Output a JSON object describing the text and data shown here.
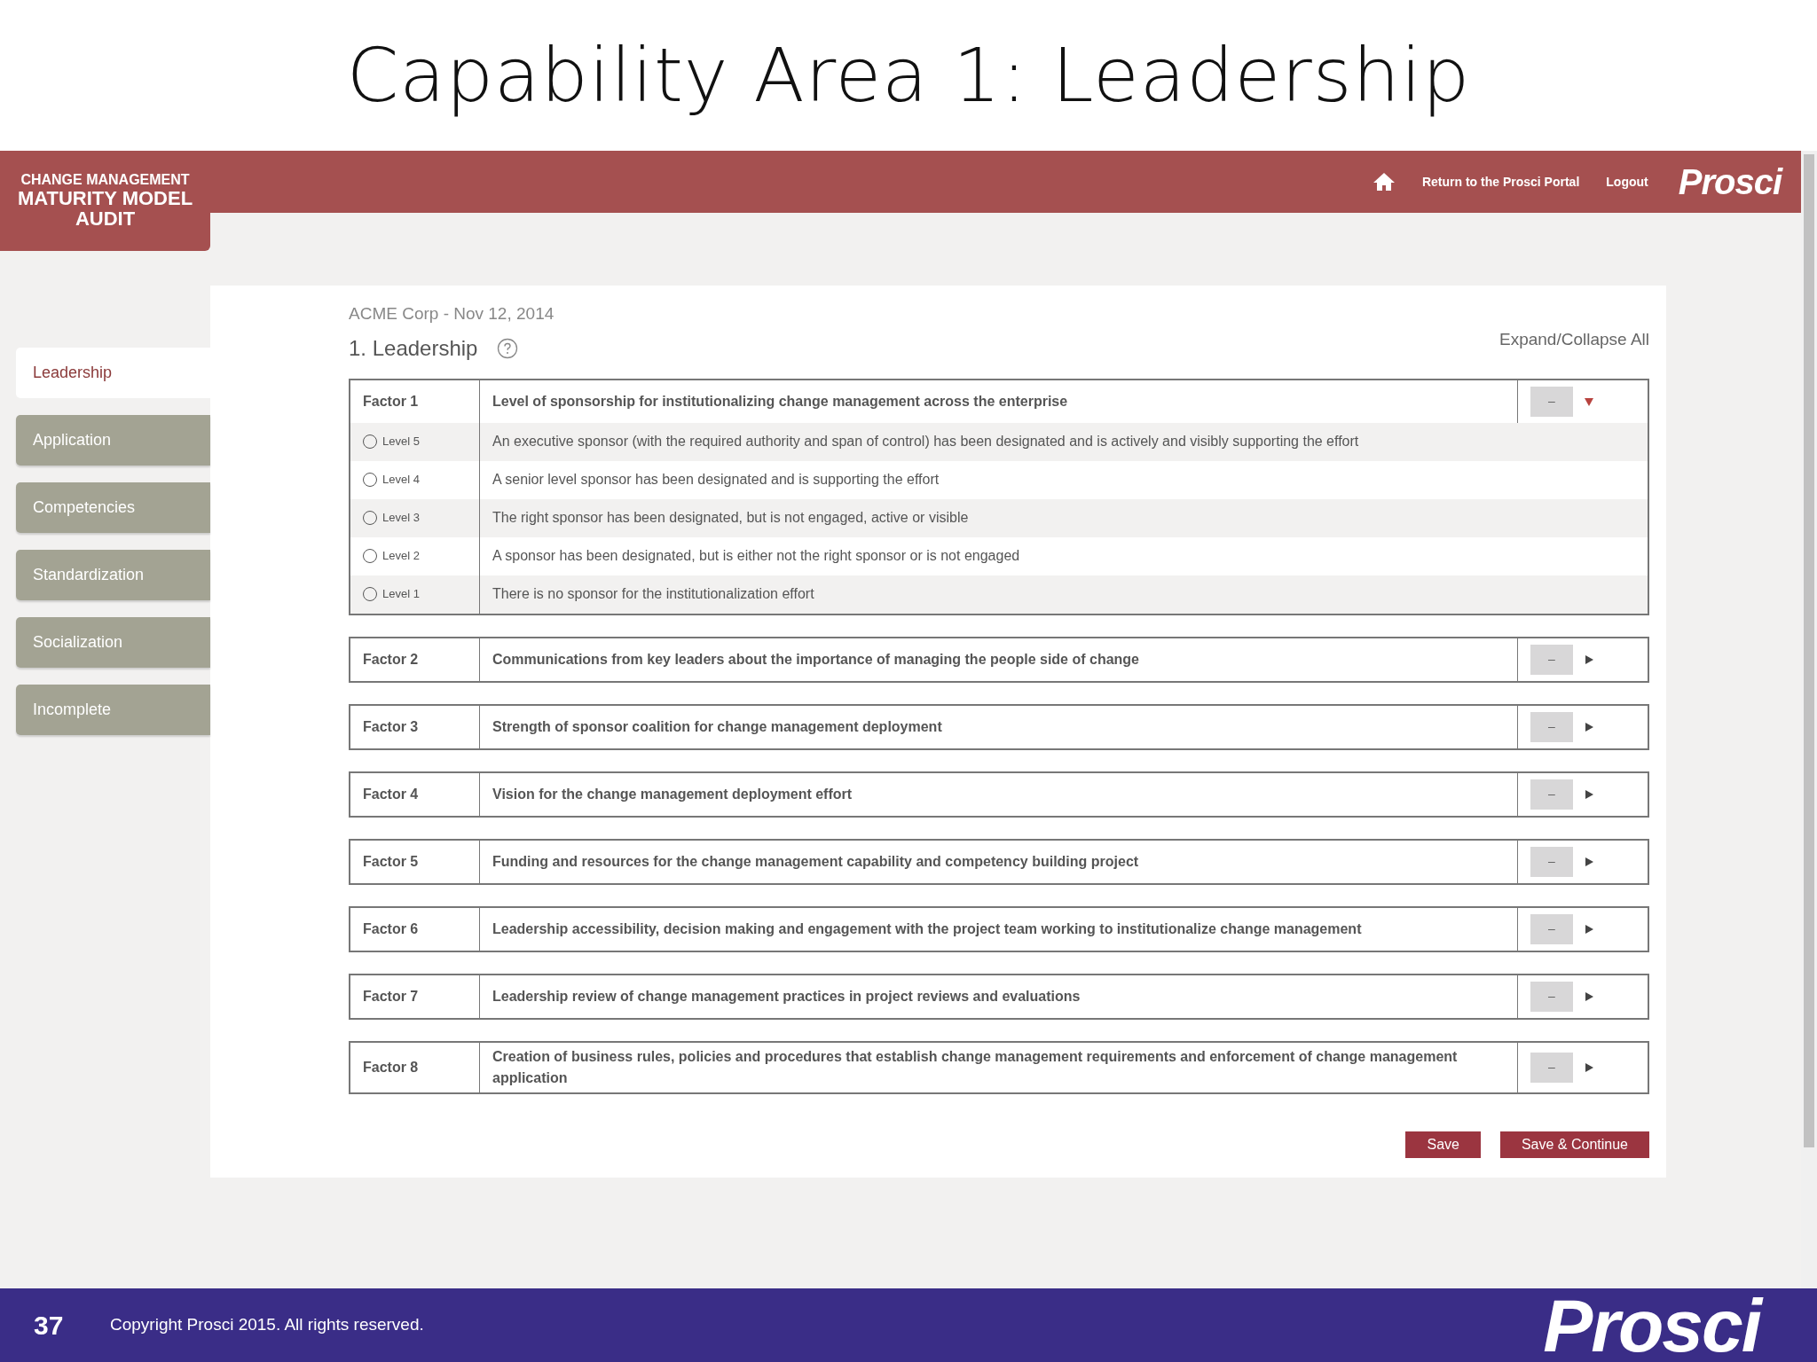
{
  "slide": {
    "title": "Capability Area 1: Leadership",
    "page_number": "37",
    "copyright": "Copyright Prosci 2015. All rights reserved.",
    "footer_logo": "Prosci"
  },
  "app": {
    "logo_lines": [
      "CHANGE MANAGEMENT",
      "MATURITY MODEL",
      "AUDIT"
    ],
    "nav_links": [
      "Return to the Prosci Portal",
      "Logout"
    ],
    "brand": "Prosci",
    "sidebar": [
      {
        "label": "Leadership",
        "selected": true
      },
      {
        "label": "Application",
        "selected": false
      },
      {
        "label": "Competencies",
        "selected": false
      },
      {
        "label": "Standardization",
        "selected": false
      },
      {
        "label": "Socialization",
        "selected": false
      },
      {
        "label": "Incomplete",
        "selected": false
      }
    ],
    "company_date": "ACME Corp - Nov 12, 2014",
    "section_title": "1. Leadership",
    "expand_all": "Expand/Collapse All",
    "factors": [
      {
        "label": "Factor 1",
        "title": "Level of sponsorship for institutionalizing change management across the enterprise",
        "score": "–",
        "expanded": true,
        "levels": [
          {
            "label": "Level 5",
            "text": "An executive sponsor (with the required authority and span of control) has been designated and is actively and visibly supporting the effort",
            "checked": false
          },
          {
            "label": "Level 4",
            "text": "A senior level sponsor has been designated and is supporting the effort",
            "checked": false
          },
          {
            "label": "Level 3",
            "text": "The right sponsor has been designated, but is not engaged, active or visible",
            "checked": false
          },
          {
            "label": "Level 2",
            "text": "A sponsor has been designated, but is either not the right sponsor or is not engaged",
            "checked": false
          },
          {
            "label": "Level 1",
            "text": "There is no sponsor for the institutionalization effort",
            "checked": false
          }
        ]
      },
      {
        "label": "Factor 2",
        "title": "Communications from key leaders about the importance of managing the people side of change",
        "score": "–",
        "expanded": false
      },
      {
        "label": "Factor 3",
        "title": "Strength of sponsor coalition for change management deployment",
        "score": "–",
        "expanded": false
      },
      {
        "label": "Factor 4",
        "title": "Vision for the change management deployment effort",
        "score": "–",
        "expanded": false
      },
      {
        "label": "Factor 5",
        "title": "Funding and resources for the change management capability and competency building project",
        "score": "–",
        "expanded": false
      },
      {
        "label": "Factor 6",
        "title": "Leadership accessibility, decision making and engagement with the project team working to institutionalize change management",
        "score": "–",
        "expanded": false
      },
      {
        "label": "Factor 7",
        "title": "Leadership review of change management practices in project reviews and evaluations",
        "score": "–",
        "expanded": false
      },
      {
        "label": "Factor 8",
        "title": "Creation of business rules, policies and procedures that establish change management requirements and enforcement of change management application",
        "score": "–",
        "expanded": false
      }
    ],
    "buttons": [
      "Save",
      "Save & Continue"
    ]
  }
}
